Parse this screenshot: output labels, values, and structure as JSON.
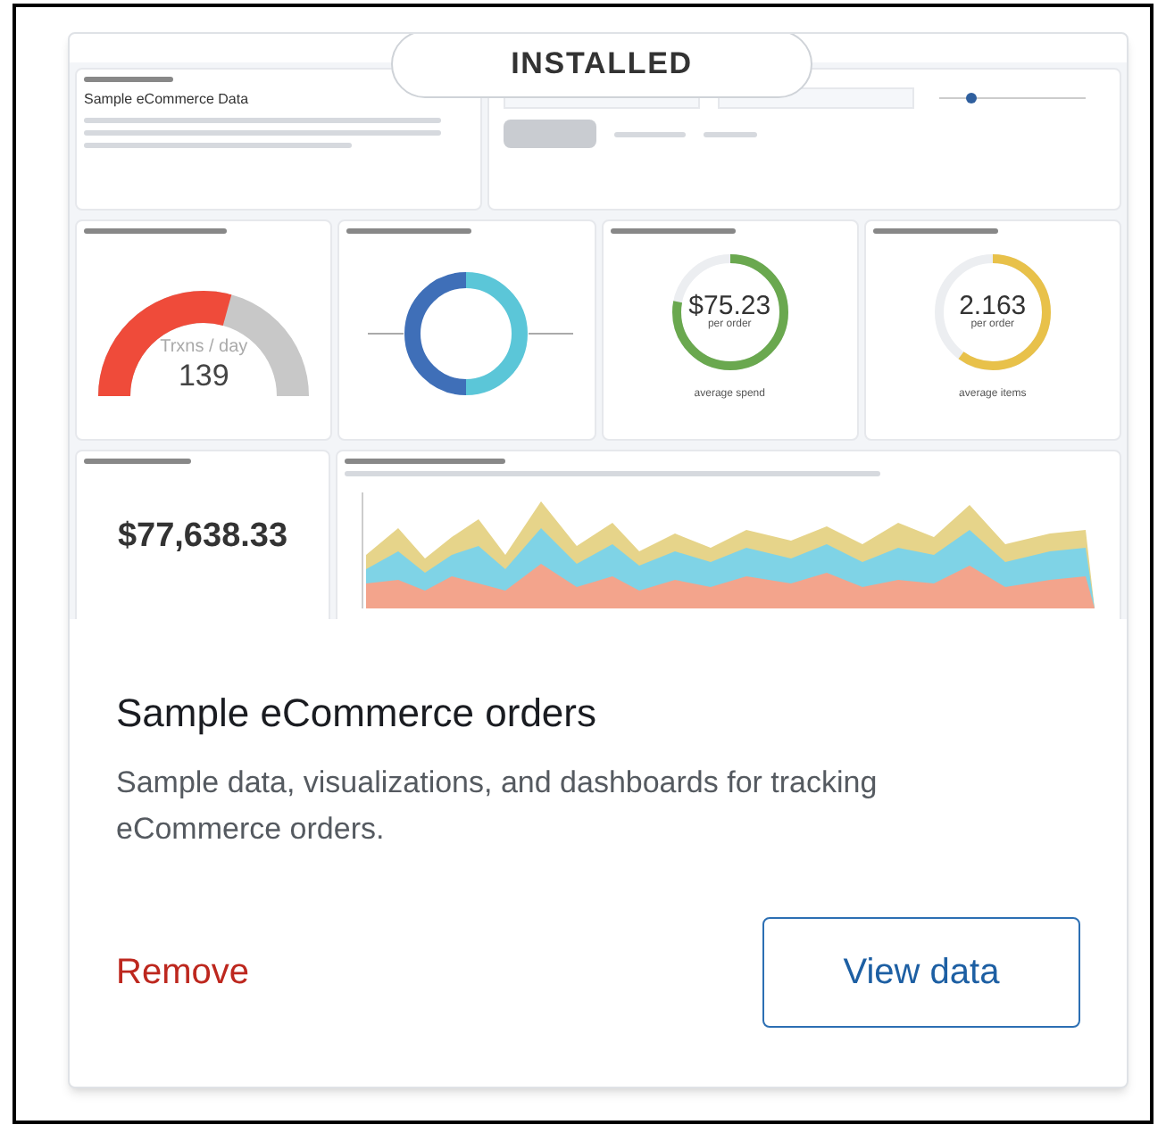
{
  "badge": "INSTALLED",
  "preview": {
    "title": "Sample eCommerce Data",
    "gauge": {
      "label": "Trxns / day",
      "value": "139"
    },
    "rings": [
      {
        "value": "$75.23",
        "unit": "per order",
        "caption": "average spend",
        "color": "#6aa84f"
      },
      {
        "value": "2.163",
        "unit": "per order",
        "caption": "average items",
        "color": "#e8c14a"
      }
    ],
    "total": "$77,638.33"
  },
  "title": "Sample eCommerce orders",
  "description": "Sample data, visualizations, and dashboards for tracking eCommerce orders.",
  "actions": [
    {
      "kind": "link",
      "label": "Remove"
    },
    {
      "kind": "button",
      "label": "View data"
    }
  ]
}
